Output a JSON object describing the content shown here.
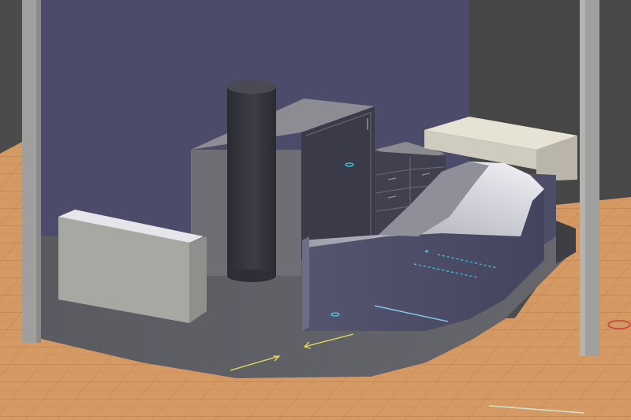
{
  "scene": {
    "kind": "3D architectural render - reception desk area",
    "colors": {
      "back_wall": "#4c4b6a",
      "dark_void": "#4b4b4b",
      "floor_wood": "#d59a63",
      "floor_grid": "#b07a48",
      "pillar": "#9fa09e",
      "platform": "#5b5b62",
      "cabinet": "#6e6e74",
      "cylinder": "#36363e",
      "counter_top": "#e7e6ec",
      "desk_front": "#4a4a66",
      "bench_top": "#e6e3d5",
      "marker_yellow": "#e8dc5a",
      "marker_cyan": "#3fd0e0",
      "marker_red": "#c43a3a"
    }
  }
}
